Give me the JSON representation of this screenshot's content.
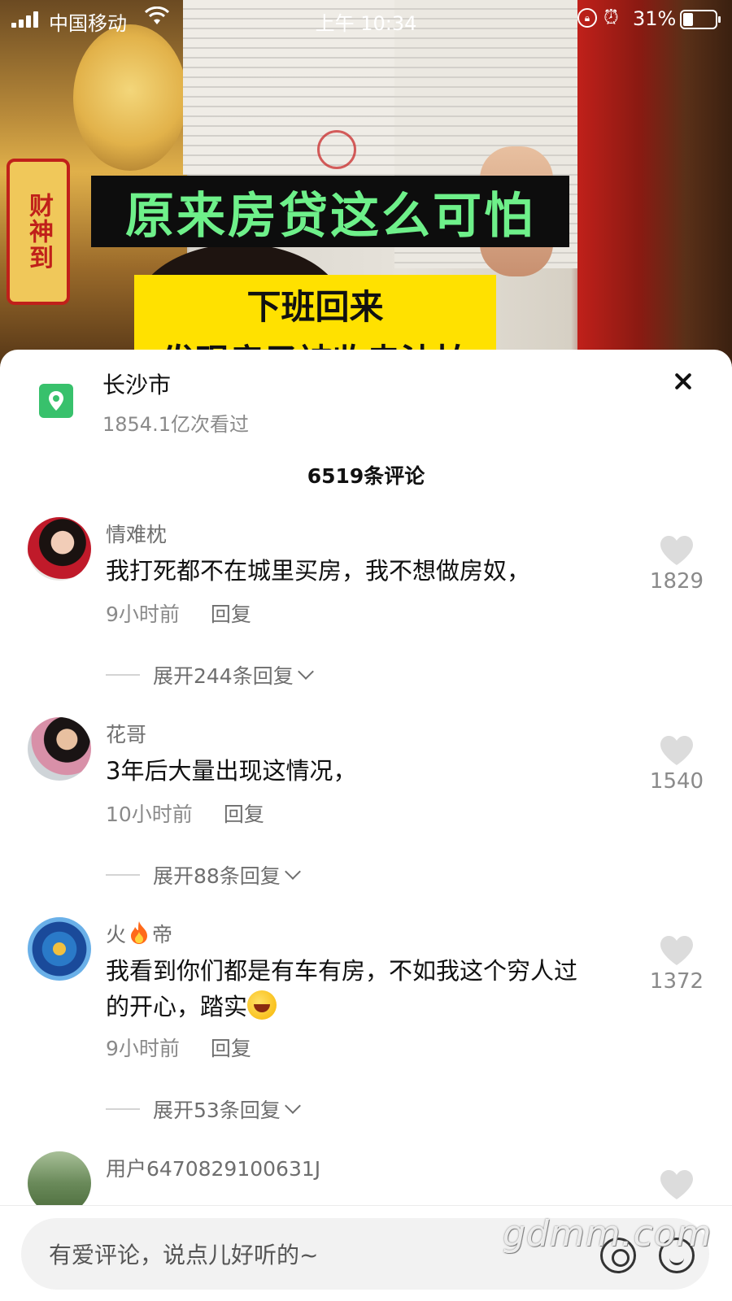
{
  "status_bar": {
    "carrier": "中国移动",
    "time": "上午 10:34",
    "battery_percent": "31%",
    "battery_level": 0.31
  },
  "video": {
    "banner_text": "财神到",
    "overlay_title": "原来房贷这么可怕",
    "overlay_sub_line1": "下班回来",
    "overlay_sub_line2": "发现房子被收走法拍",
    "colors": {
      "title_text": "#6ef08a",
      "title_bg": "#0d0d0d",
      "sub_bg": "#ffe100"
    }
  },
  "location": {
    "name": "长沙市",
    "views": "1854.1亿次看过",
    "icon": "location-pin-icon",
    "icon_color": "#38c16c"
  },
  "comment_count": "6519条评论",
  "comments": [
    {
      "user": "情难枕",
      "text": "我打死都不在城里买房，我不想做房奴，",
      "time": "9小时前",
      "reply": "回复",
      "likes": "1829",
      "expand": "展开244条回复"
    },
    {
      "user": "花哥",
      "text": "3年后大量出现这情况，",
      "time": "10小时前",
      "reply": "回复",
      "likes": "1540",
      "expand": "展开88条回复"
    },
    {
      "user_a": "火",
      "user_b": "帝",
      "text_line1": "我看到你们都是有车有房，不如我这个穷人过",
      "text_line2": "的开心，踏实",
      "time": "9小时前",
      "reply": "回复",
      "likes": "1372",
      "expand": "展开53条回复"
    },
    {
      "user": "用户6470829100631J"
    }
  ],
  "input": {
    "placeholder": "有爱评论，说点儿好听的~"
  },
  "watermark": "gdmm.com"
}
